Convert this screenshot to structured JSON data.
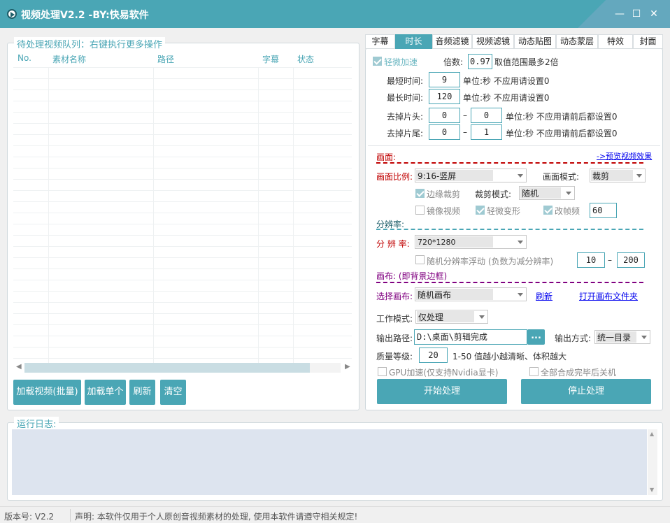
{
  "window": {
    "title": "视频处理V2.2 -BY:快易软件"
  },
  "queue": {
    "group_title": "待处理视频队列：右键执行更多操作",
    "columns": [
      "No.",
      "素材名称",
      "路径",
      "字幕",
      "状态"
    ],
    "buttons": {
      "load_batch": "加载视频(批量)",
      "load_single": "加载单个",
      "refresh": "刷新",
      "clear": "清空"
    }
  },
  "tabs": [
    "字幕",
    "时长",
    "音频滤镜",
    "视频滤镜",
    "动态贴图",
    "动态蒙层",
    "特效",
    "封面"
  ],
  "duration": {
    "light_speed_label": "轻微加速",
    "multiplier_label": "倍数:",
    "multiplier_value": "0.97",
    "multiplier_hint": "取值范围最多2倍",
    "min_time_label": "最短时间:",
    "min_time_value": "9",
    "max_time_label": "最长时间:",
    "max_time_value": "120",
    "unit_hint": "单位:秒  不应用请设置0",
    "cut_head_label": "去掉片头:",
    "cut_head_from": "0",
    "cut_head_to": "0",
    "cut_tail_label": "去掉片尾:",
    "cut_tail_from": "0",
    "cut_tail_to": "1",
    "range_dash": "–",
    "range_hint": "单位:秒  不应用请前后都设置0"
  },
  "picture": {
    "section_label": "画面:",
    "preview_link": "->预览视频效果",
    "ratio_label": "画面比例:",
    "ratio_value": "9:16-竖屏",
    "mode_label": "画面模式:",
    "mode_value": "裁剪",
    "edge_crop_label": "边缘裁剪",
    "crop_mode_label": "裁剪模式:",
    "crop_mode_value": "随机",
    "mirror_label": "镜像视频",
    "light_deform_label": "轻微变形",
    "change_fps_label": "改帧频",
    "fps_value": "60"
  },
  "resolution": {
    "section_label": "分辨率:",
    "label": "分 辨 率:",
    "value": "720*1280",
    "random_label": "随机分辨率浮动 (负数为减分辨率)",
    "random_from": "10",
    "random_to": "200",
    "range_dash": "–"
  },
  "canvas": {
    "section_label": "画布: (即背景边框)",
    "select_label": "选择画布:",
    "select_value": "随机画布",
    "refresh_link": "刷新",
    "open_folder_link": "打开画布文件夹"
  },
  "output": {
    "work_mode_label": "工作模式:",
    "work_mode_value": "仅处理",
    "path_label": "输出路径:",
    "path_value": "D:\\桌面\\剪辑完成",
    "browse_label": "...",
    "method_label": "输出方式:",
    "method_value": "统一目录",
    "quality_label": "质量等级:",
    "quality_value": "20",
    "quality_hint": "1-50 值越小越清晰、体积越大",
    "gpu_label": "GPU加速(仅支持Nvidia显卡)",
    "shutdown_label": "全部合成完毕后关机",
    "start_button": "开始处理",
    "stop_button": "停止处理"
  },
  "log": {
    "group_title": "运行日志:"
  },
  "status": {
    "version": "版本号: V2.2",
    "notice": "声明: 本软件仅用于个人原创音视频素材的处理, 使用本软件请遵守相关规定!"
  },
  "colors": {
    "accent": "#4aa6b5",
    "red": "#c00000",
    "purple": "#800080",
    "log_bg": "#dde4ef"
  }
}
